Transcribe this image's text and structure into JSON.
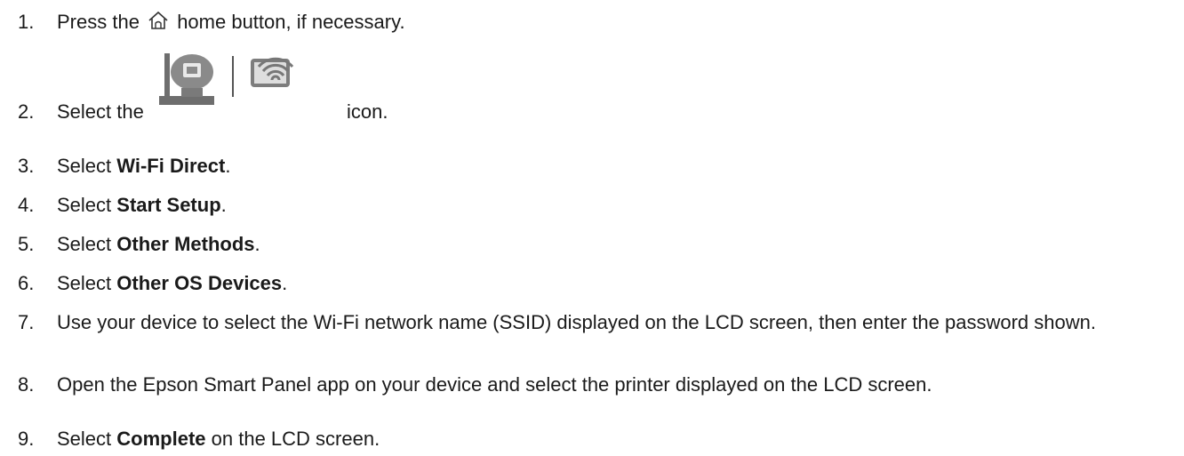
{
  "steps": [
    {
      "num": "1.",
      "pre": "Press the",
      "post": "home button, if necessary."
    },
    {
      "num": "2.",
      "pre": "Select the",
      "post": "icon."
    },
    {
      "num": "3.",
      "pre": "Select",
      "bold": "Wi-Fi Direct",
      "post": "."
    },
    {
      "num": "4.",
      "pre": "Select",
      "bold": "Start Setup",
      "post": "."
    },
    {
      "num": "5.",
      "pre": "Select",
      "bold": "Other Methods",
      "post": "."
    },
    {
      "num": "6.",
      "pre": "Select",
      "bold": "Other OS Devices",
      "post": "."
    },
    {
      "num": "7.",
      "text": "Use your device to select the Wi-Fi network name (SSID) displayed on the LCD screen, then enter the password shown."
    },
    {
      "num": "8.",
      "text": "Open the Epson Smart Panel app on your device and select the printer displayed on the LCD screen."
    },
    {
      "num": "9.",
      "pre": "Select",
      "bold": "Complete",
      "post": "on the LCD screen."
    }
  ],
  "icons": {
    "step1": "home-icon",
    "step2_left": "printer-router-icon",
    "step2_right": "smartphone-wifi-icon"
  }
}
